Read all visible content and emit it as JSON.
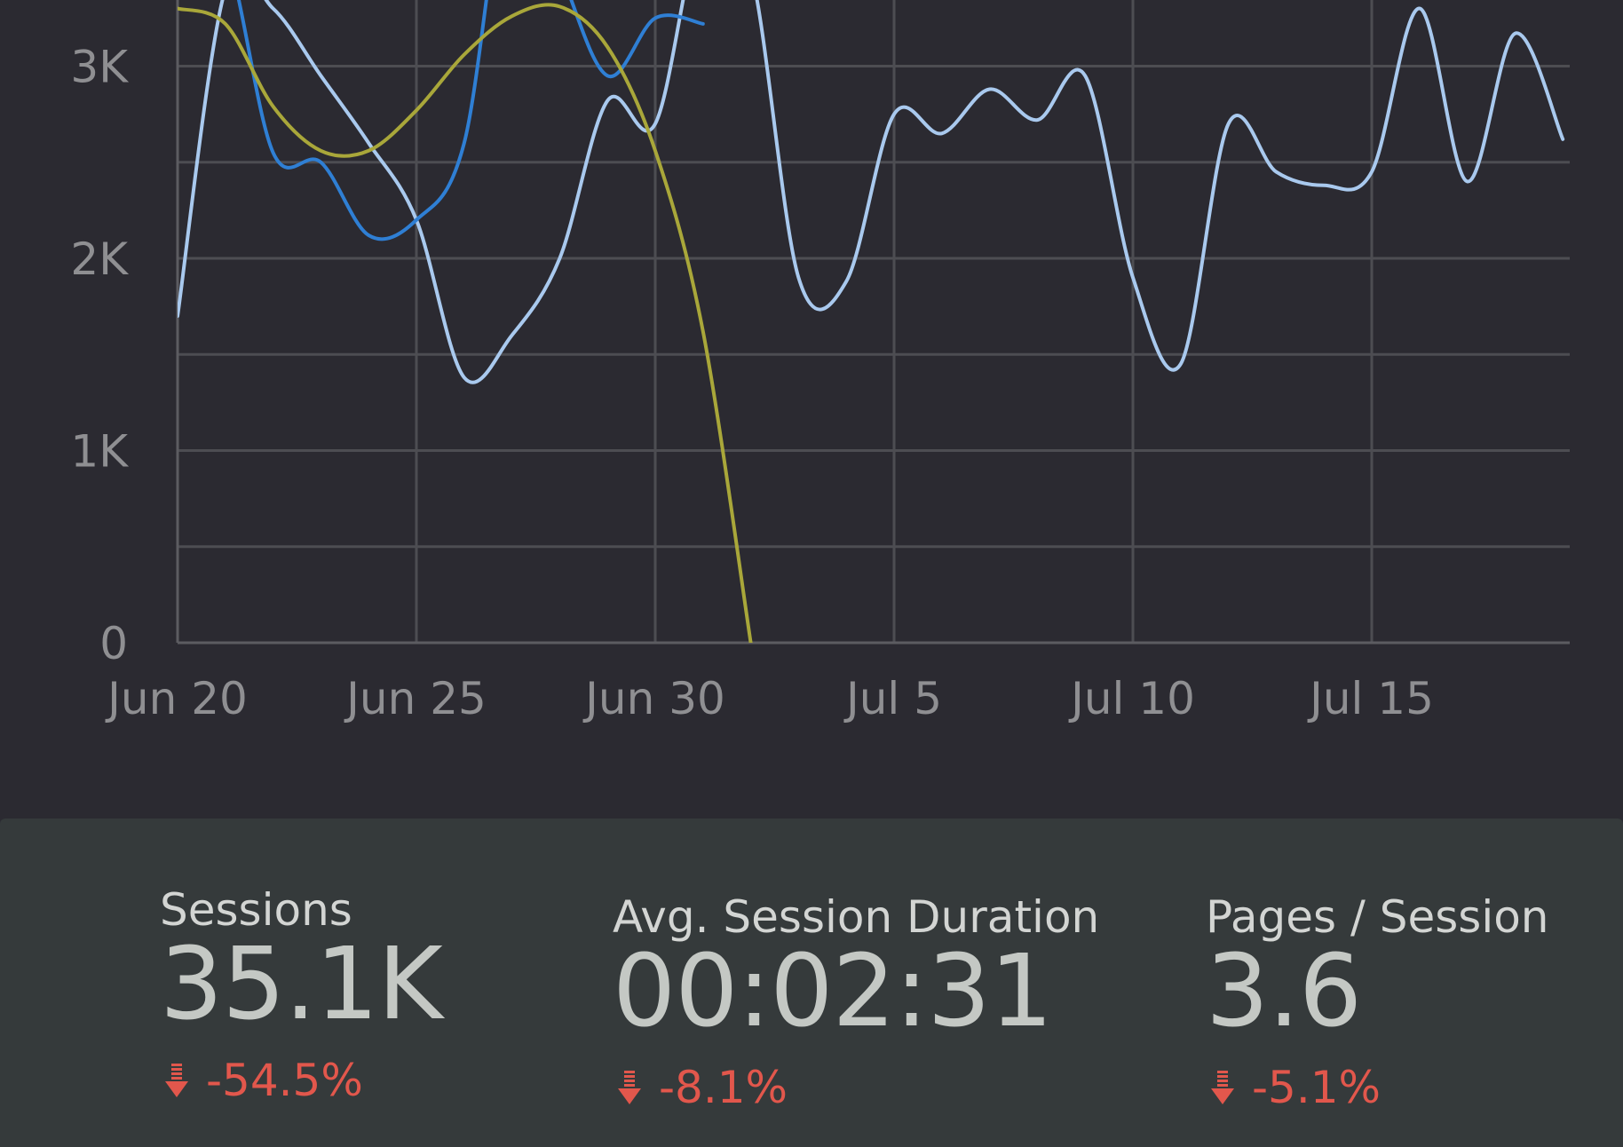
{
  "colors": {
    "background": "#2b2a31",
    "stats_background": "#353a3b",
    "grid": "#4d4d52",
    "tick_text": "#8f8f92",
    "delta_negative": "#e2574c"
  },
  "chart_data": {
    "type": "line",
    "title": "",
    "xlabel": "",
    "ylabel": "",
    "x_ticks": [
      "Jun 20",
      "Jun 25",
      "Jun 30",
      "Jul 5",
      "Jul 10",
      "Jul 15"
    ],
    "y_ticks": [
      "0",
      "1K",
      "2K",
      "3K"
    ],
    "ylim": [
      0,
      3200
    ],
    "grid": true,
    "x_dates": [
      "Jun 20",
      "Jun 21",
      "Jun 22",
      "Jun 23",
      "Jun 24",
      "Jun 25",
      "Jun 26",
      "Jun 27",
      "Jun 28",
      "Jun 29",
      "Jun 30",
      "Jul 1",
      "Jul 2",
      "Jul 3",
      "Jul 4",
      "Jul 5",
      "Jul 6",
      "Jul 7",
      "Jul 8",
      "Jul 9",
      "Jul 10",
      "Jul 11",
      "Jul 12",
      "Jul 13",
      "Jul 14",
      "Jul 15",
      "Jul 16",
      "Jul 17",
      "Jul 18",
      "Jul 19"
    ],
    "series": [
      {
        "color": "#a9c9ee",
        "values": [
          1700,
          3400,
          3300,
          2950,
          2600,
          2200,
          1380,
          1600,
          2000,
          2820,
          2700,
          3750,
          3500,
          1900,
          1880,
          2750,
          2650,
          2880,
          2720,
          2950,
          1900,
          1450,
          2700,
          2450,
          2380,
          2450,
          3300,
          2400,
          3170,
          2620
        ]
      },
      {
        "color": "#2f7fd4",
        "values": [
          3700,
          3600,
          2550,
          2500,
          2120,
          2200,
          2600,
          4100,
          3500,
          2950,
          3250,
          3220
        ]
      },
      {
        "color": "#a9a73a",
        "trend": true,
        "values": [
          3300,
          3220,
          2790,
          2560,
          2560,
          2770,
          3060,
          3260,
          3310,
          3100,
          2560,
          1620,
          0
        ]
      }
    ]
  },
  "stats": {
    "sessions": {
      "label": "Sessions",
      "value": "35.1K",
      "delta": "-54.5%",
      "direction": "down"
    },
    "duration": {
      "label": "Avg. Session Duration",
      "value": "00:02:31",
      "delta": "-8.1%",
      "direction": "down"
    },
    "pages": {
      "label": "Pages / Session",
      "value": "3.6",
      "delta": "-5.1%",
      "direction": "down"
    }
  }
}
